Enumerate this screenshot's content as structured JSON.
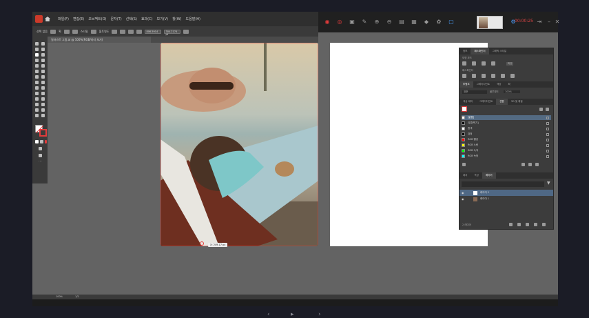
{
  "window": {
    "app_icon": "Ai"
  },
  "menu": [
    "파일(F)",
    "편집(E)",
    "오브젝트(O)",
    "문자(T)",
    "선택(S)",
    "효과(C)",
    "보기(V)",
    "창(W)",
    "도움말(H)"
  ],
  "control_bar": {
    "selection_label": "선택 없음",
    "stroke_label": "획",
    "style_label": "스타일",
    "opacity_label": "불투명도",
    "x_value": "806.5914",
    "y_value": "304.2174 pt"
  },
  "document_tab": {
    "title": "일러스트 그림.ai @ 100%(RGB/미리 보기)"
  },
  "recorder": {
    "timer": "00:00:25",
    "icons": [
      "record-icon",
      "pause-icon",
      "edit-icon",
      "pen-icon",
      "zoom-icon",
      "zoom-out-icon",
      "doc-icon",
      "layers-icon",
      "drop-icon",
      "palette-icon",
      "frame-icon",
      "settings-icon"
    ]
  },
  "status_bar": {
    "zoom": "100%",
    "page": "1/2"
  },
  "measure_tag": "X: 249.17 px",
  "panel": {
    "top_tabs": [
      "정보",
      "패스파인더",
      "그래픽 스타일"
    ],
    "shape_modes_label": "모양 모드",
    "pathfinder_label": "패스파인더",
    "apply_label": "확장",
    "color_tabs": [
      "투명도",
      "그레이디언트",
      "색상",
      "획"
    ],
    "blend_mode": "표준",
    "opacity_label": "불투명도",
    "opacity_value": "100%",
    "swatch_tabs": [
      "색상 테마",
      "그레이디언트",
      "견본",
      "3D 및 재질"
    ],
    "swatches": [
      {
        "name": "[없음]",
        "color": "#ffffff",
        "selected": true
      },
      {
        "name": "[맞춰찍기]",
        "color": "#000000",
        "selected": false
      },
      {
        "name": "흰색",
        "color": "#ffffff",
        "selected": false
      },
      {
        "name": "검정",
        "color": "#000000",
        "selected": false
      },
      {
        "name": "RGB 빨강",
        "color": "#ff0000",
        "selected": false
      },
      {
        "name": "RGB 노랑",
        "color": "#ffff00",
        "selected": false
      },
      {
        "name": "RGB 녹색",
        "color": "#00ff00",
        "selected": false
      },
      {
        "name": "RGB 녹청",
        "color": "#00ffff",
        "selected": false
      }
    ],
    "layer_tabs": [
      "대지",
      "속성",
      "레이어"
    ],
    "search_placeholder": "",
    "layers": [
      {
        "name": "레이어 2",
        "selected": true
      },
      {
        "name": "레이어 1",
        "selected": false
      }
    ],
    "layer_count": "2 레이어"
  },
  "colors": {
    "accent_red": "#e23b3b",
    "selection_blue": "#4f6885"
  }
}
